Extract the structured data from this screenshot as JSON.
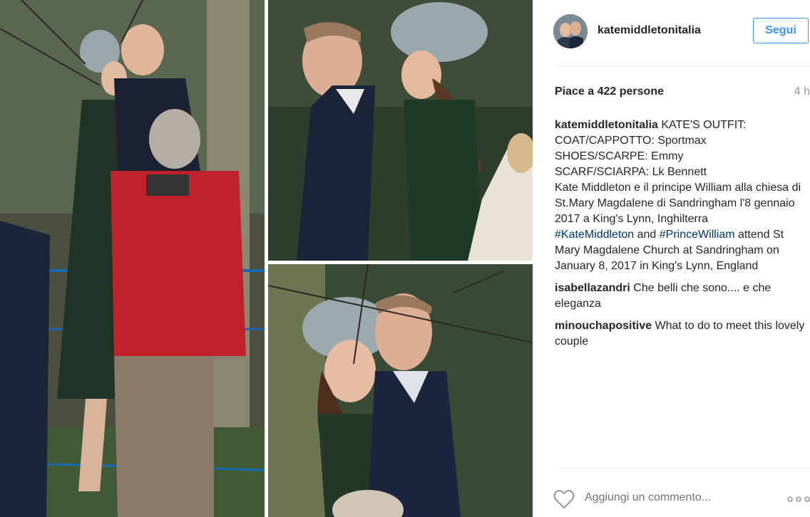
{
  "post": {
    "username": "katemiddletonitalia",
    "follow_label": "Segui",
    "likes_text": "Piace a 422 persone",
    "time_ago": "4 h",
    "comment_placeholder": "Aggiungi un commento...",
    "more_label": "...",
    "photo_alts": [
      "Kate Middleton e il principe William con il pubblico",
      "Kate Middleton e il principe William camminano",
      "Kate Middleton e il principe William sorridono"
    ]
  },
  "caption": {
    "username": "katemiddletonitalia",
    "line_outfit": "KATE'S OUTFIT:",
    "line_coat": "COAT/CAPPOTTO: Sportmax",
    "line_shoes": "SHOES/SCARPE: Emmy",
    "line_scarf": "SCARF/SCIARPA: Lk Bennett",
    "line_italian": "Kate Middleton e il principe William alla chiesa di St.Mary Magdalene di Sandringham l'8 gennaio 2017 a King's Lynn, Inghilterra",
    "tag1": "#KateMiddleton",
    "and_word": " and ",
    "tag2": "#PrinceWilliam",
    "line_english": " attend St Mary Magdalene Church at Sandringham on January 8, 2017 in King's Lynn, England"
  },
  "comments": [
    {
      "user": "isabellazandri",
      "text": "Che belli che sono.... e che eleganza"
    },
    {
      "user": "minouchapositive",
      "text": "What to do to meet this lovely couple"
    }
  ],
  "colors": {
    "accent": "#3897f0",
    "hashtag": "#003569",
    "muted": "#999999",
    "separator": "#efefef"
  },
  "icons": [
    "heart-icon",
    "more-options-icon"
  ]
}
